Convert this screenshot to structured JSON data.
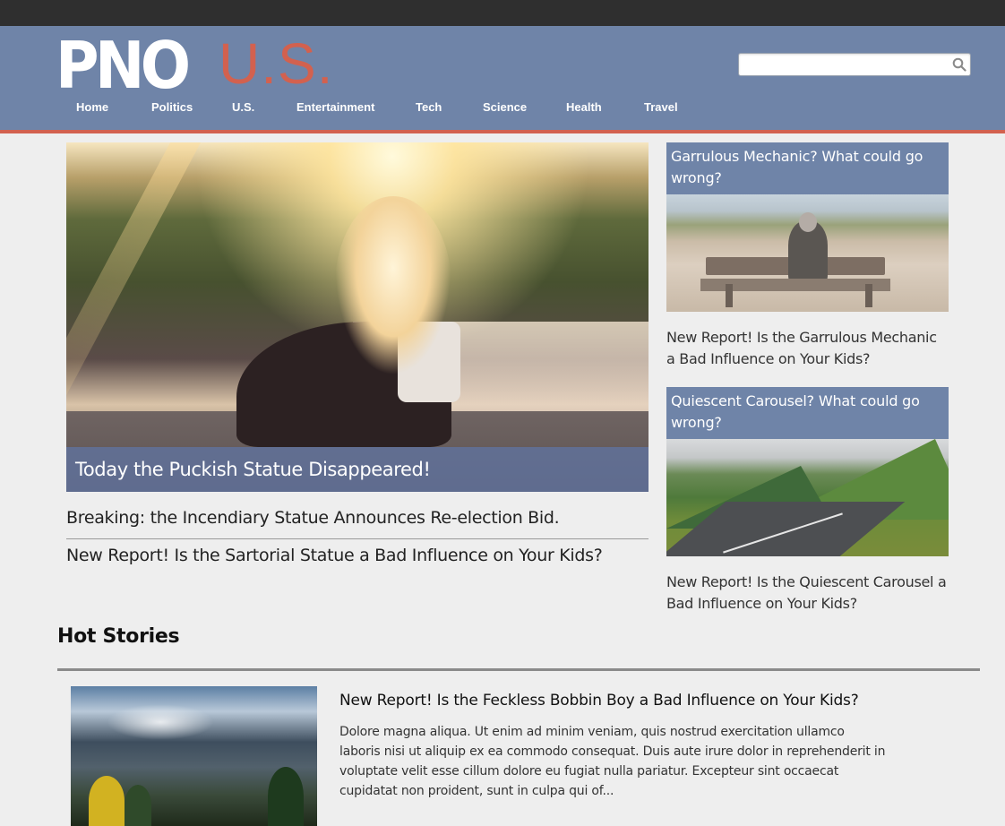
{
  "header": {
    "logo_main": "PNO",
    "logo_section": "U.S.",
    "search": {
      "value": "",
      "placeholder": ""
    },
    "nav": [
      {
        "label": "Home"
      },
      {
        "label": "Politics"
      },
      {
        "label": "U.S."
      },
      {
        "label": "Entertainment"
      },
      {
        "label": "Tech"
      },
      {
        "label": "Science"
      },
      {
        "label": "Health"
      },
      {
        "label": "Travel"
      }
    ]
  },
  "hero": {
    "caption": "Today the Puckish Statue Disappeared!",
    "links": [
      "Breaking: the Incendiary Statue Announces Re-election Bid.",
      "New Report! Is the Sartorial Statue a Bad Influence on Your Kids?"
    ]
  },
  "sidebar": [
    {
      "heading": "Garrulous Mechanic? What could go wrong?",
      "text": "New Report! Is the Garrulous Mechanic a Bad Influence on Your Kids?"
    },
    {
      "heading": "Quiescent Carousel? What could go wrong?",
      "text": "New Report! Is the Quiescent Carousel a Bad Influence on Your Kids?"
    }
  ],
  "hot_stories": {
    "title": "Hot Stories",
    "items": [
      {
        "title": "New Report! Is the Feckless Bobbin Boy a Bad Influence on Your Kids?",
        "excerpt": "Dolore magna aliqua. Ut enim ad minim veniam, quis nostrud exercitation ullamco laboris nisi ut aliquip ex ea commodo consequat. Duis aute irure dolor in reprehenderit in voluptate velit esse cillum dolore eu fugiat nulla pariatur. Excepteur sint occaecat cupidatat non proident, sunt in culpa qui of..."
      }
    ]
  },
  "colors": {
    "header_bg": "#6f84a8",
    "accent": "#d2614f",
    "topbar": "#2f2f2f",
    "page_bg": "#eeeeee"
  }
}
